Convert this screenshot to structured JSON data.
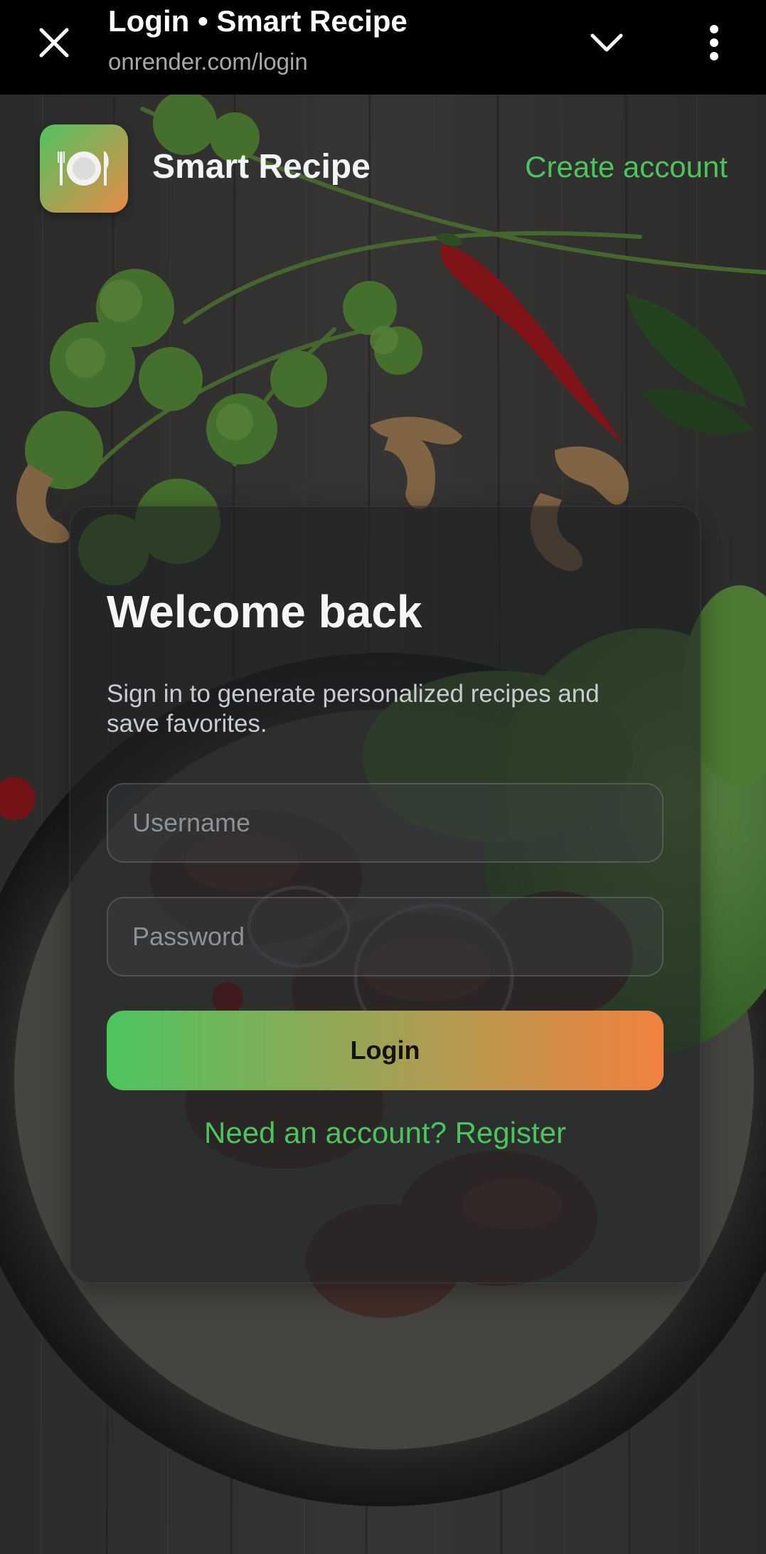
{
  "browser": {
    "title": "Login • Smart Recipe",
    "url": "onrender.com/login",
    "close_icon": "close-icon",
    "expand_icon": "chevron-down-icon",
    "menu_icon": "more-vert-icon"
  },
  "header": {
    "logo_icon": "plate-cutlery-icon",
    "brand": "Smart Recipe",
    "create_account": "Create account"
  },
  "login_card": {
    "title": "Welcome back",
    "subtitle": "Sign in to generate personalized recipes and save favorites.",
    "username_placeholder": "Username",
    "username_value": "",
    "password_placeholder": "Password",
    "password_value": "",
    "login_button": "Login",
    "register_link": "Need an account? Register"
  },
  "colors": {
    "accent_green": "#4cc45e",
    "accent_orange": "#f1813f",
    "browser_bar": "#000000"
  }
}
